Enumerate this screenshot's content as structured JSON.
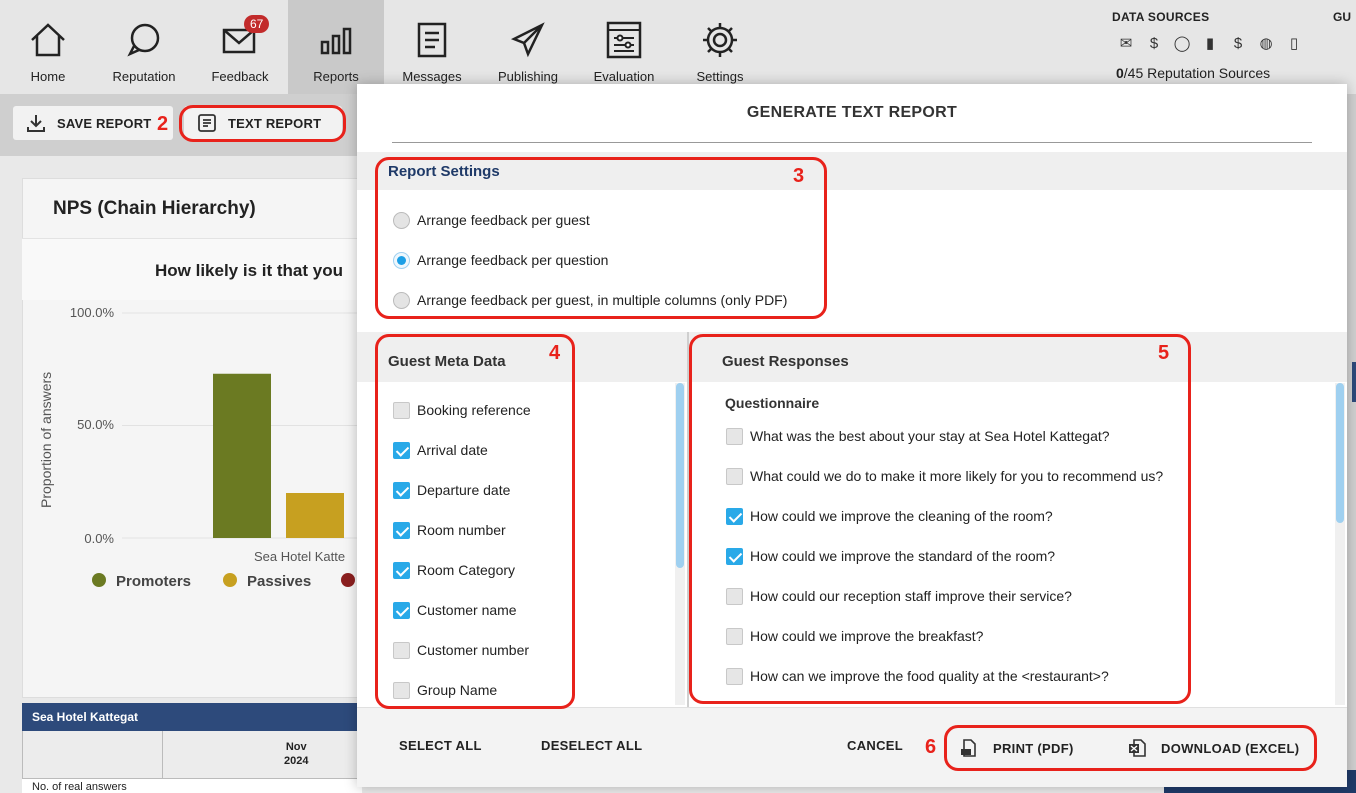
{
  "nav": {
    "items": [
      {
        "label": "Home",
        "icon": "home-icon"
      },
      {
        "label": "Reputation",
        "icon": "chat-bubble-icon"
      },
      {
        "label": "Feedback",
        "icon": "envelope-icon",
        "badge": "67"
      },
      {
        "label": "Reports",
        "icon": "bar-chart-icon",
        "active": true
      },
      {
        "label": "Messages",
        "icon": "document-icon"
      },
      {
        "label": "Publishing",
        "icon": "paper-plane-icon"
      },
      {
        "label": "Evaluation",
        "icon": "sliders-icon"
      },
      {
        "label": "Settings",
        "icon": "gear-icon"
      }
    ],
    "data_sources": {
      "title": "DATA SOURCES",
      "count_strong": "0",
      "count_rest": "/45 Reputation Sources"
    },
    "gu_label": "GU"
  },
  "toolbar": {
    "save_report": "SAVE REPORT",
    "text_report": "TEXT REPORT"
  },
  "report": {
    "title": "NPS (Chain Hierarchy)",
    "question": "How likely is it that you",
    "chart_data": {
      "type": "bar",
      "ylabel": "Proportion of answers",
      "yticks": [
        "100.0%",
        "50.0%",
        "0.0%"
      ],
      "ylim": [
        0,
        100
      ],
      "categories": [
        "Sea Hotel Katte"
      ],
      "series": [
        {
          "name": "Promoters",
          "values": [
            73
          ],
          "color": "#6b7a22"
        },
        {
          "name": "Passives",
          "values": [
            20
          ],
          "color": "#c7a020"
        },
        {
          "name": "",
          "values": [
            0
          ],
          "color": "#8b1f1f"
        }
      ]
    },
    "table_title": "Sea Hotel Kattegat",
    "month": "Nov",
    "year": "2024",
    "row_label": "No. of real answers"
  },
  "modal": {
    "title": "GENERATE TEXT REPORT",
    "settings": {
      "title": "Report Settings",
      "options": [
        {
          "label": "Arrange feedback per guest",
          "selected": false
        },
        {
          "label": "Arrange feedback per question",
          "selected": true
        },
        {
          "label": "Arrange feedback per guest, in multiple columns (only PDF)",
          "selected": false
        }
      ]
    },
    "meta": {
      "title": "Guest Meta Data",
      "items": [
        {
          "label": "Booking reference",
          "checked": false
        },
        {
          "label": "Arrival date",
          "checked": true
        },
        {
          "label": "Departure date",
          "checked": true
        },
        {
          "label": "Room number",
          "checked": true
        },
        {
          "label": "Room Category",
          "checked": true
        },
        {
          "label": "Customer name",
          "checked": true
        },
        {
          "label": "Customer number",
          "checked": false
        },
        {
          "label": "Group Name",
          "checked": false
        }
      ]
    },
    "responses": {
      "title": "Guest Responses",
      "subtitle": "Questionnaire",
      "items": [
        {
          "label": "What was the best about your stay at Sea Hotel Kattegat?",
          "checked": false
        },
        {
          "label": "What could we do to make it more likely for you to recommend us?",
          "checked": false
        },
        {
          "label": "How could we improve the cleaning of the room?",
          "checked": true
        },
        {
          "label": "How could we improve the standard of the room?",
          "checked": true
        },
        {
          "label": "How could our reception staff improve their service?",
          "checked": false
        },
        {
          "label": "How could we improve the breakfast?",
          "checked": false
        },
        {
          "label": "How can we improve the food quality at the <restaurant>?",
          "checked": false
        }
      ]
    },
    "footer": {
      "select_all": "SELECT ALL",
      "deselect_all": "DESELECT ALL",
      "cancel": "CANCEL",
      "print": "PRINT (PDF)",
      "download": "DOWNLOAD (EXCEL)"
    }
  },
  "annotations": [
    "2",
    "3",
    "4",
    "5",
    "6"
  ],
  "colors": {
    "annotation": "#e8221b",
    "checkbox_on": "#29a9e8",
    "navy": "#1f3a68"
  }
}
